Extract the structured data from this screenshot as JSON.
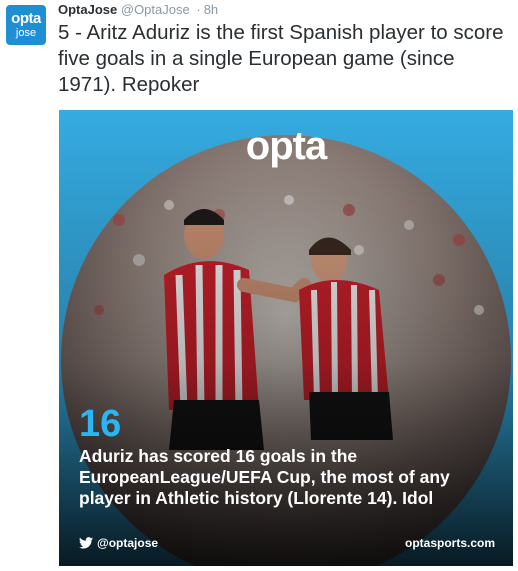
{
  "tweet": {
    "avatar_line1": "opta",
    "avatar_line2": "jose",
    "author_name": "OptaJose",
    "author_handle": "@OptaJose",
    "separator": "·",
    "time": "8h",
    "text": "5 - Aritz Aduriz is the first Spanish player to score five goals in a single European game (since 1971). Repoker"
  },
  "card": {
    "logo": "opta",
    "stat_number": "16",
    "stat_text": "Aduriz has scored 16 goals in the EuropeanLeague/UEFA Cup, the most of any player in Athletic history (Llorente 14). Idol",
    "handle": "@optajose",
    "handle_icon": "twitter-bird-icon",
    "site": "optasports.com"
  },
  "colors": {
    "card_blue": "#1da0dc",
    "stat_blue": "#2bb5f2",
    "avatar_blue": "#1f8fd4"
  }
}
